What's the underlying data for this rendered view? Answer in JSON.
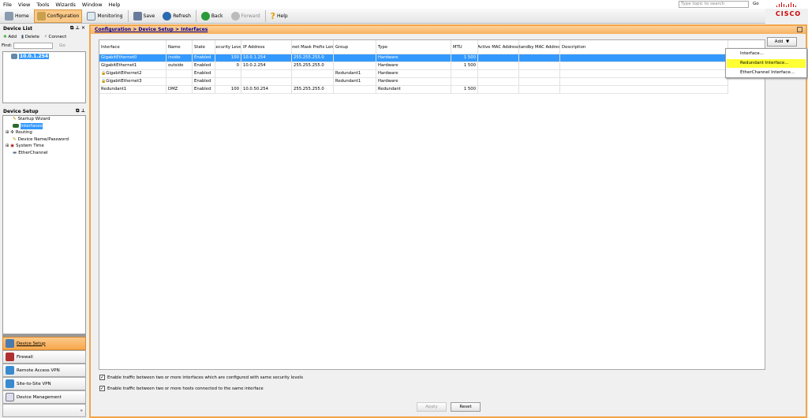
{
  "menu": [
    "File",
    "View",
    "Tools",
    "Wizards",
    "Window",
    "Help"
  ],
  "toolbar": {
    "home": "Home",
    "configuration": "Configuration",
    "monitoring": "Monitoring",
    "save": "Save",
    "refresh": "Refresh",
    "back": "Back",
    "forward": "Forward",
    "help": "Help"
  },
  "search": {
    "placeholder": "Type topic to search",
    "go": "Go"
  },
  "brand": "CISCO",
  "device_list": {
    "title": "Device List",
    "add": "Add",
    "delete": "Delete",
    "connect": "Connect",
    "find_label": "Find:",
    "go": "Go",
    "devices": [
      "10.0.1.254"
    ]
  },
  "device_setup": {
    "title": "Device Setup",
    "items": [
      "Startup Wizard",
      "Interfaces",
      "Routing",
      "Device Name/Password",
      "System Time",
      "EtherChannel"
    ],
    "selected": "Interfaces"
  },
  "nav": [
    "Device Setup",
    "Firewall",
    "Remote Access VPN",
    "Site-to-Site VPN",
    "Device Management"
  ],
  "breadcrumb": "Configuration > Device Setup > Interfaces",
  "table": {
    "columns": [
      "Interface",
      "Name",
      "State",
      "Security Level",
      "IP Address",
      "Subnet Mask Prefix Length",
      "Group",
      "Type",
      "MTU",
      "Active MAC Address",
      "Standby MAC Address",
      "Description"
    ],
    "rows": [
      [
        "GigabitEthernet0",
        "inside",
        "Enabled",
        "100",
        "10.0.1.254",
        "255.255.255.0",
        "",
        "Hardware",
        "1 500",
        "",
        "",
        ""
      ],
      [
        "GigabitEthernet1",
        "outside",
        "Enabled",
        "0",
        "10.0.2.254",
        "255.255.255.0",
        "",
        "Hardware",
        "1 500",
        "",
        "",
        ""
      ],
      [
        "GigabitEthernet2",
        "",
        "Enabled",
        "",
        "",
        "",
        "Redundant1",
        "Hardware",
        "",
        "",
        "",
        ""
      ],
      [
        "GigabitEthernet3",
        "",
        "Enabled",
        "",
        "",
        "",
        "Redundant1",
        "Hardware",
        "",
        "",
        "",
        ""
      ],
      [
        "Redundant1",
        "DMZ",
        "Enabled",
        "100",
        "10.0.50.254",
        "255.255.255.0",
        "",
        "Redundant",
        "1 500",
        "",
        "",
        ""
      ]
    ],
    "locked_rows": [
      2,
      3
    ],
    "selected_row": 0
  },
  "add_button": "Add",
  "add_menu": [
    "Interface...",
    "Redundant Interface...",
    "EtherChannel Interface..."
  ],
  "add_menu_highlighted": "Redundant Interface...",
  "checkboxes": [
    {
      "label": "Enable traffic between two or more interfaces which are configured with same security levels",
      "checked": true
    },
    {
      "label": "Enable traffic between two or more hosts connected to the same interface",
      "checked": true
    }
  ],
  "apply": "Apply",
  "reset": "Reset",
  "colors": {
    "accent": "#f2a54a",
    "selection": "#3399ff",
    "highlight": "#ffff33",
    "cisco": "#cc0000"
  }
}
